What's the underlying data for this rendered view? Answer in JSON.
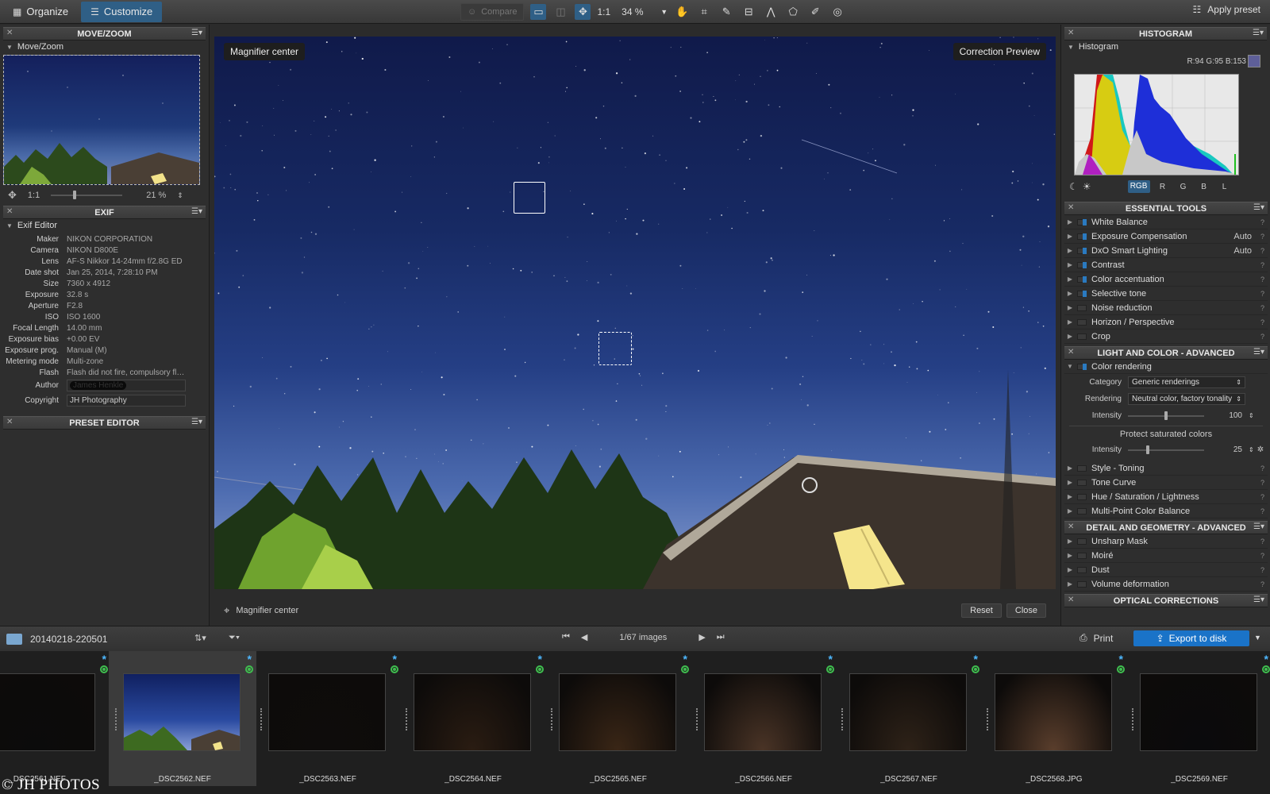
{
  "toolbar": {
    "tabs": [
      {
        "label": "Organize"
      },
      {
        "label": "Customize"
      }
    ],
    "compare_label": "Compare",
    "ratio_label": "1:1",
    "zoom_value": "34 %",
    "apply_preset_label": "Apply preset"
  },
  "left": {
    "movezoom": {
      "title": "MOVE/ZOOM",
      "subtitle": "Move/Zoom",
      "ratio": "1:1",
      "zoom": "21 %",
      "zoom_level": 0.32
    },
    "exif": {
      "title": "EXIF",
      "subtitle": "Exif Editor",
      "rows": [
        {
          "k": "Maker",
          "v": "NIKON CORPORATION"
        },
        {
          "k": "Camera",
          "v": "NIKON D800E"
        },
        {
          "k": "Lens",
          "v": "AF-S Nikkor 14-24mm f/2.8G ED"
        },
        {
          "k": "Date shot",
          "v": "Jan 25, 2014, 7:28:10 PM"
        },
        {
          "k": "Size",
          "v": "7360 x 4912"
        },
        {
          "k": "Exposure",
          "v": "32.8 s"
        },
        {
          "k": "Aperture",
          "v": "F2.8"
        },
        {
          "k": "ISO",
          "v": "ISO 1600"
        },
        {
          "k": "Focal Length",
          "v": "14.00 mm"
        },
        {
          "k": "Exposure bias",
          "v": "+0.00 EV"
        },
        {
          "k": "Exposure prog.",
          "v": "Manual (M)"
        },
        {
          "k": "Metering mode",
          "v": "Multi-zone"
        },
        {
          "k": "Flash",
          "v": "Flash did not fire, compulsory flash…"
        }
      ],
      "author_label": "Author",
      "author_value": "James Henkle",
      "copyright_label": "Copyright",
      "copyright_value": "JH Photography"
    },
    "preset_editor": {
      "title": "PRESET EDITOR"
    }
  },
  "viewer": {
    "label_left": "Magnifier center",
    "label_right": "Correction Preview",
    "bottom_label": "Magnifier center",
    "reset_label": "Reset",
    "close_label": "Close"
  },
  "right": {
    "histogram": {
      "title": "HISTOGRAM",
      "subtitle": "Histogram",
      "rgb_readout": "R:94 G:95 B:153",
      "swatch_color": "#5e5f99",
      "channels": [
        "RGB",
        "R",
        "G",
        "B",
        "L"
      ]
    },
    "essential": {
      "title": "ESSENTIAL TOOLS",
      "items": [
        {
          "label": "White Balance",
          "val": ""
        },
        {
          "label": "Exposure Compensation",
          "val": "Auto"
        },
        {
          "label": "DxO Smart Lighting",
          "val": "Auto"
        },
        {
          "label": "Contrast",
          "val": ""
        },
        {
          "label": "Color accentuation",
          "val": ""
        },
        {
          "label": "Selective tone",
          "val": ""
        },
        {
          "label": "Noise reduction",
          "val": ""
        },
        {
          "label": "Horizon / Perspective",
          "val": ""
        },
        {
          "label": "Crop",
          "val": ""
        }
      ]
    },
    "light": {
      "title": "LIGHT AND COLOR - ADVANCED",
      "color_rendering": "Color rendering",
      "category_label": "Category",
      "category_value": "Generic renderings",
      "rendering_label": "Rendering",
      "rendering_value": "Neutral color, factory tonality",
      "intensity_label": "Intensity",
      "intensity_value": "100",
      "protect_label": "Protect saturated colors",
      "intensity2_label": "Intensity",
      "intensity2_value": "25",
      "items": [
        {
          "label": "Style - Toning"
        },
        {
          "label": "Tone Curve"
        },
        {
          "label": "Hue / Saturation / Lightness"
        },
        {
          "label": "Multi-Point Color Balance"
        }
      ]
    },
    "detail": {
      "title": "DETAIL AND GEOMETRY - ADVANCED",
      "items": [
        {
          "label": "Unsharp Mask"
        },
        {
          "label": "Moiré"
        },
        {
          "label": "Dust"
        },
        {
          "label": "Volume deformation"
        }
      ]
    },
    "optical": {
      "title": "OPTICAL CORRECTIONS"
    }
  },
  "filmbar": {
    "folder": "20140218-220501",
    "count": "1/67 images",
    "print_label": "Print",
    "export_label": "Export to disk"
  },
  "film": [
    {
      "name": "_DSC2561.NEF",
      "tone": "#0b0b0b"
    },
    {
      "name": "_DSC2562.NEF",
      "tone": "#2a4aa0"
    },
    {
      "name": "_DSC2563.NEF",
      "tone": "#0e0c0b"
    },
    {
      "name": "_DSC2564.NEF",
      "tone": "#2a1c12"
    },
    {
      "name": "_DSC2565.NEF",
      "tone": "#3a2616"
    },
    {
      "name": "_DSC2566.NEF",
      "tone": "#4a3426"
    },
    {
      "name": "_DSC2567.NEF",
      "tone": "#2e2218"
    },
    {
      "name": "_DSC2568.JPG",
      "tone": "#5a3e2c"
    },
    {
      "name": "_DSC2569.NEF",
      "tone": "#0a0a0c"
    }
  ],
  "watermark": "© JH PHOTOS"
}
